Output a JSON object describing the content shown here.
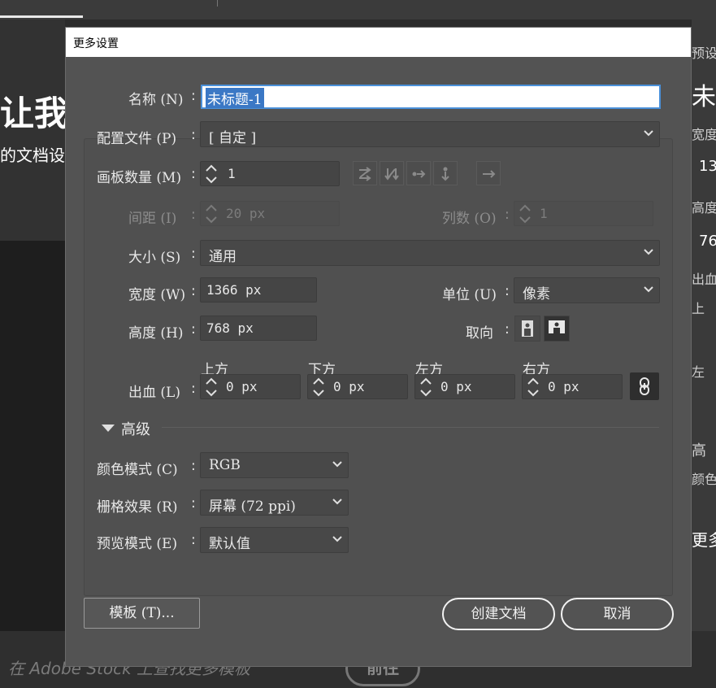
{
  "background": {
    "hero_title": "让我",
    "hero_sub": "的文档设置",
    "right_labels": [
      "预设",
      "未",
      "宽度",
      "13",
      "高度",
      "76",
      "出血",
      "上",
      "左",
      "高",
      "颜色",
      "更多"
    ],
    "stock_text": "在 Adobe Stock 上查找更多模板",
    "go_button": "前往"
  },
  "dialog": {
    "title": "更多设置",
    "name": {
      "label": "名称 (N)",
      "value": "未标题-1"
    },
    "profile": {
      "label": "配置文件 (P)",
      "value": "[ 自定 ]"
    },
    "artboards": {
      "label": "画板数量 (M)",
      "value": "1"
    },
    "spacing": {
      "label": "间距 (I)",
      "value": "20 px"
    },
    "columns": {
      "label": "列数 (O)",
      "value": "1"
    },
    "size": {
      "label": "大小 (S)",
      "value": "通用"
    },
    "width": {
      "label": "宽度 (W)",
      "value": "1366 px"
    },
    "height": {
      "label": "高度 (H)",
      "value": "768 px"
    },
    "units": {
      "label": "单位 (U)",
      "value": "像素"
    },
    "orientation": {
      "label": "取向"
    },
    "bleed": {
      "label": "出血 (L)",
      "top_label": "上方",
      "top": "0 px",
      "bottom_label": "下方",
      "bottom": "0 px",
      "left_label": "左方",
      "left": "0 px",
      "right_label": "右方",
      "right": "0 px"
    },
    "advanced": {
      "label": "高级"
    },
    "color_mode": {
      "label": "颜色模式 (C)",
      "value": "RGB"
    },
    "raster": {
      "label": "栅格效果 (R)",
      "value": "屏幕 (72 ppi)"
    },
    "preview": {
      "label": "预览模式 (E)",
      "value": "默认值"
    },
    "buttons": {
      "templates": "模板 (T)...",
      "create": "创建文档",
      "cancel": "取消"
    }
  }
}
